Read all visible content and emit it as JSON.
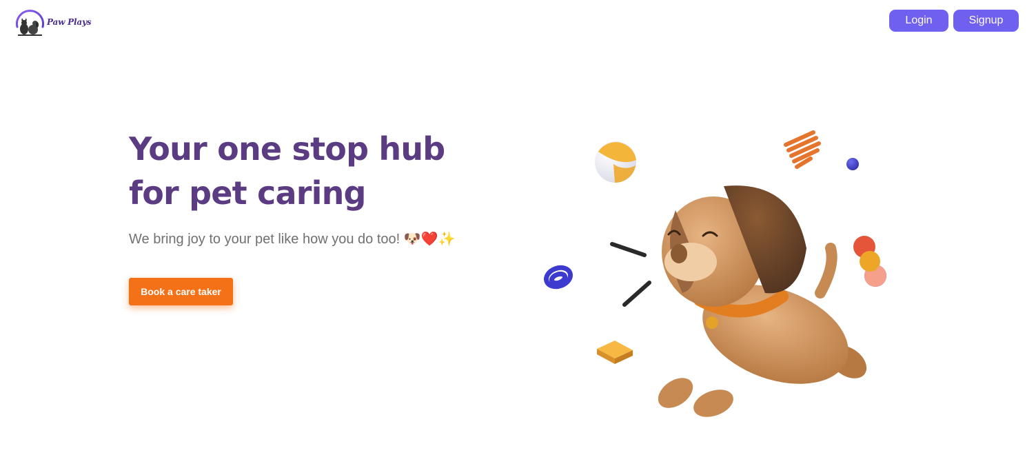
{
  "nav": {
    "brand": "Paw Plays",
    "login_label": "Login",
    "signup_label": "Signup",
    "button_color": "#7060f0"
  },
  "hero": {
    "title": "Your one stop hub for pet caring",
    "subtitle": "We bring joy to your pet like how you do too! 🐶❤️✨",
    "cta_label": "Book a care taker",
    "title_color": "#5b3c82",
    "cta_color": "#f57118"
  },
  "illustration": {
    "name": "puppy-with-toys-illustration"
  }
}
